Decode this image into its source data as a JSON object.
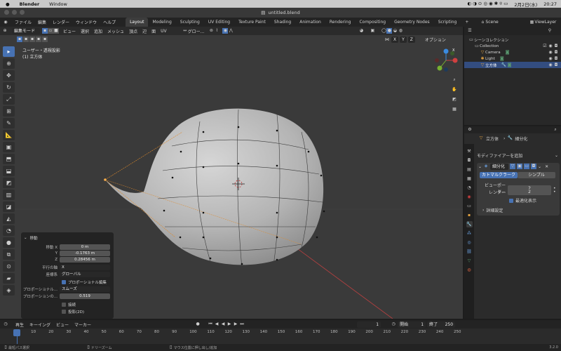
{
  "mac_menu": {
    "apple": "",
    "app": "Blender",
    "items": [
      "Window"
    ],
    "date": "2月2日(水)",
    "time": "20:27"
  },
  "window": {
    "title": "untitled.blend"
  },
  "topbar": {
    "menus": [
      "ファイル",
      "編集",
      "レンダー",
      "ウィンドウ",
      "ヘルプ"
    ],
    "workspaces": [
      "Layout",
      "Modeling",
      "Sculpting",
      "UV Editing",
      "Texture Paint",
      "Shading",
      "Animation",
      "Rendering",
      "Compositing",
      "Geometry Nodes",
      "Scripting"
    ],
    "active_workspace": "Layout",
    "add_tab": "+",
    "scene_label": "Scene",
    "viewlayer_label": "ViewLayer"
  },
  "viewport_header": {
    "mode": "編集モード",
    "menus": [
      "ビュー",
      "選択",
      "追加",
      "メッシュ",
      "頂点",
      "辺",
      "面",
      "UV"
    ],
    "orientation": "グロー...",
    "xyz": [
      "X",
      "Y",
      "Z"
    ],
    "options": "オプション"
  },
  "viewport": {
    "view_name": "ユーザー・透視投影",
    "object_name": "(1) 立方体",
    "gizmo": {
      "x": "X",
      "y": "Y",
      "z": "Z"
    }
  },
  "operator_panel": {
    "title": "移動",
    "move_x_label": "移動 X",
    "move_x": "0 m",
    "move_y_label": "Y",
    "move_y": "-0.1763 m",
    "move_z_label": "Z",
    "move_z": "0.28456 m",
    "parallel_axis_label": "平行の軸",
    "parallel_axis": "X",
    "coord_system_label": "座標系",
    "coord_system": "グローバル",
    "proportional_edit": "プロポーショナル編集",
    "prop_falloff_label": "プロポーショナル...",
    "prop_falloff": "スムーズ",
    "prop_size_label": "プロポーションの...",
    "prop_size": "0.519",
    "connected": "接続",
    "projected": "投影(2D)"
  },
  "outliner": {
    "scene_collection": "シーンコレクション",
    "items": [
      {
        "name": "Collection"
      },
      {
        "name": "Camera"
      },
      {
        "name": "Light"
      },
      {
        "name": "立方体"
      }
    ]
  },
  "properties": {
    "object_name": "立方体",
    "modifier_name": "細分化",
    "add_modifier": "モディファイアーを追加",
    "mod_panel_name": "細分化",
    "catmull": "カトマルクラーク",
    "simple": "シンプル",
    "viewport_levels_label": "ビューポート...",
    "viewport_levels": "2",
    "render_levels_label": "レンダー",
    "render_levels": "2",
    "optimal_display": "最適化表示",
    "advanced": "詳細設定"
  },
  "timeline": {
    "menus": [
      "再生",
      "キーイング",
      "ビュー",
      "マーカー"
    ],
    "current_frame": "1",
    "start_label": "開始",
    "start": "1",
    "end_label": "終了",
    "end": "250",
    "ticks": [
      "1",
      "10",
      "20",
      "30",
      "40",
      "50",
      "60",
      "70",
      "80",
      "90",
      "100",
      "110",
      "120",
      "130",
      "140",
      "150",
      "160",
      "170",
      "180",
      "190",
      "200",
      "210",
      "220",
      "230",
      "240",
      "250"
    ]
  },
  "statusbar": {
    "left": "最短パス選択",
    "mid": "ドリーズーム",
    "hint": "マウス位置に押し出し/追加",
    "version": "3.2.0"
  },
  "colors": {
    "accent": "#4772b3",
    "bg": "#3a3a3a",
    "panel": "#2b2b2b"
  }
}
